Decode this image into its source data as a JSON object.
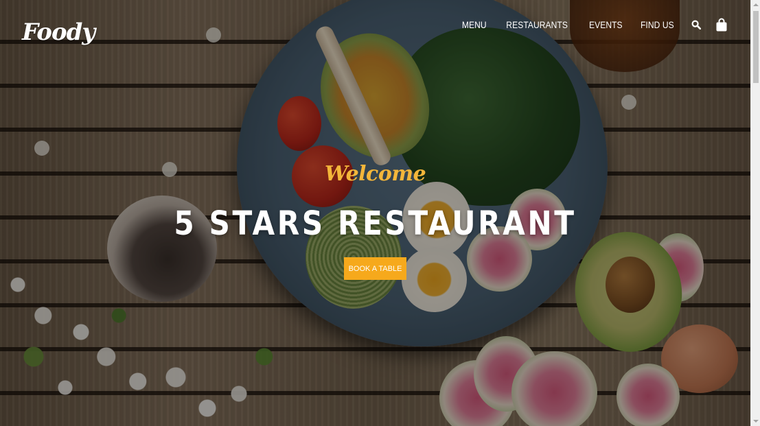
{
  "brand": {
    "logo_text": "Foody"
  },
  "nav": {
    "items": [
      {
        "label": "MENU"
      },
      {
        "label": "RESTAURANTS"
      },
      {
        "label": "EVENTS"
      },
      {
        "label": "FIND US"
      }
    ],
    "search_icon": "search-icon",
    "cart_icon": "shopping-bag-icon"
  },
  "hero": {
    "welcome": "Welcome",
    "headline": "5 STARS RESTAURANT",
    "cta_label": "BOOK A TABLE"
  },
  "colors": {
    "accent": "#f6a91c",
    "welcome_text": "#f4b63a",
    "nav_text": "#ffffff"
  }
}
